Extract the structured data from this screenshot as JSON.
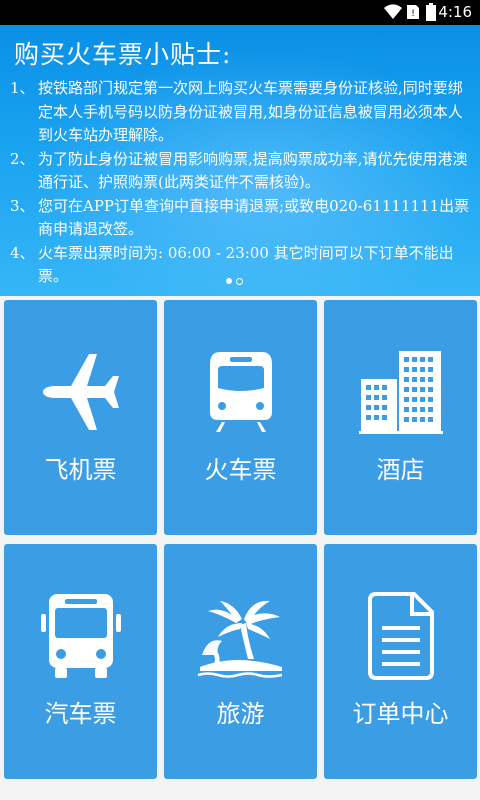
{
  "status_bar": {
    "time": "4:16"
  },
  "banner": {
    "title": "购买火车票小贴士:",
    "tips": [
      {
        "num": "1、",
        "text": "按铁路部门规定第一次网上购买火车票需要身份证核验,同时要绑定本人手机号码以防身份证被冒用,如身份证信息被冒用必须本人到火车站办理解除。"
      },
      {
        "num": "2、",
        "text": "为了防止身份证被冒用影响购票,提高购票成功率,请优先使用港澳通行证、护照购票(此两类证件不需核验)。"
      },
      {
        "num": "3、",
        "text": "您可在APP订单查询中直接申请退票;或致电020-61111111出票商申请退改签。"
      },
      {
        "num": "4、",
        "text": "火车票出票时间为: 06:00 - 23:00 其它时间可以下订单不能出票。"
      }
    ],
    "page_indicator": {
      "current": 1,
      "total": 2
    }
  },
  "menu": {
    "tiles": [
      {
        "label": "飞机票",
        "icon": "airplane-icon"
      },
      {
        "label": "火车票",
        "icon": "train-icon"
      },
      {
        "label": "酒店",
        "icon": "hotel-building-icon"
      },
      {
        "label": "汽车票",
        "icon": "bus-icon"
      },
      {
        "label": "旅游",
        "icon": "palm-tree-island-icon"
      },
      {
        "label": "订单中心",
        "icon": "document-icon"
      }
    ]
  },
  "colors": {
    "tile_bg": "#3b9de4",
    "banner_top": "#0a8fe6",
    "banner_bottom": "#36b6f6",
    "page_bg": "#f4f4f4"
  }
}
